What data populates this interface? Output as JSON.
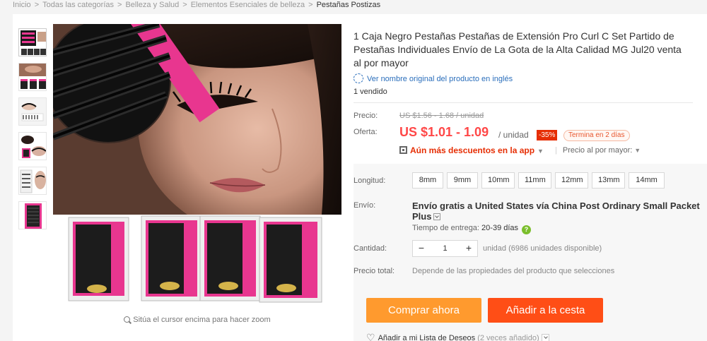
{
  "breadcrumb": [
    "Inicio",
    "Todas las categorías",
    "Belleza y Salud",
    "Elementos Esenciales de belleza",
    "Pestañas Postizas"
  ],
  "breadcrumb_separator": ">",
  "product": {
    "title": "1 Caja Negro Pestañas Pestañas de Extensión Pro Curl C Set Partido de Pestañas Individuales Envío de La Gota de la Alta Calidad MG Jul20 venta al por mayor",
    "translate_link": "Ver nombre original del producto en inglés",
    "sold": "1 vendido"
  },
  "price": {
    "label_old": "Precio:",
    "old_price": "US $1.56 - 1.68 / unidad",
    "label_new": "Oferta:",
    "new_price": "US $1.01 - 1.09",
    "unit": "/ unidad",
    "discount": "-35%",
    "ends": "Termina en 2 días",
    "app_deal": "Aún más descuentos en la app",
    "wholesale": "Precio al por mayor:"
  },
  "length": {
    "label": "Longitud:",
    "options": [
      "8mm",
      "9mm",
      "10mm",
      "11mm",
      "12mm",
      "13mm",
      "14mm"
    ]
  },
  "shipping": {
    "label": "Envío:",
    "text": "Envío gratis a United States vía China Post Ordinary Small Packet Plus",
    "delivery_label": "Tiempo de entrega:",
    "delivery_days": "20-39 días"
  },
  "quantity": {
    "label": "Cantidad:",
    "minus": "−",
    "value": "1",
    "plus": "+",
    "available": "unidad (6986 unidades disponible)"
  },
  "total": {
    "label": "Precio total:",
    "note": "Depende de las propiedades del producto que selecciones"
  },
  "actions": {
    "buy_now": "Comprar ahora",
    "add_cart": "Añadir a la cesta",
    "wishlist": "Añadir a mi Lista de Deseos",
    "wishlist_count": "(2 veces añadido)"
  },
  "zoom_hint": "Sitúa el cursor encima para hacer zoom",
  "colors": {
    "price_red": "#ff4747",
    "buy_now_orange": "#ff9a2e",
    "add_cart_red": "#ff4e16",
    "link_blue": "#2a6ebb",
    "lash_pink": "#e8368f"
  }
}
